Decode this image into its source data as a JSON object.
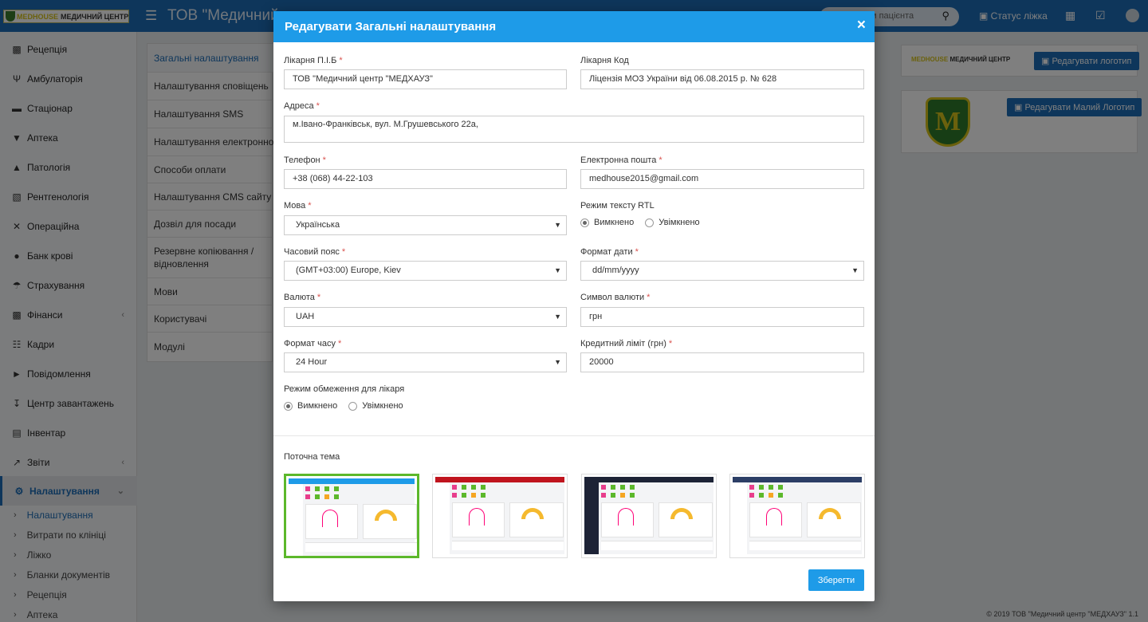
{
  "app": {
    "logo_text_green": "MEDHOUSE",
    "logo_text": "МЕДИЧНИЙ ЦЕНТР",
    "title": "ТОВ \"Медичний",
    "search_placeholder": "ям пацієнта",
    "status_label": "Статус ліжка",
    "footer": "© 2019 ТОВ \"Медичний центр \"МЕДХАУЗ\" 1.1"
  },
  "sidebar": {
    "items": [
      {
        "label": "Рецепція",
        "icon": "reception-icon"
      },
      {
        "label": "Амбулаторія",
        "icon": "stethoscope-icon"
      },
      {
        "label": "Стаціонар",
        "icon": "bed-icon"
      },
      {
        "label": "Аптека",
        "icon": "pharmacy-icon"
      },
      {
        "label": "Патологія",
        "icon": "flask-icon"
      },
      {
        "label": "Рентгенологія",
        "icon": "xray-icon"
      },
      {
        "label": "Операційна",
        "icon": "scissors-icon"
      },
      {
        "label": "Банк крові",
        "icon": "blood-drop-icon"
      },
      {
        "label": "Страхування",
        "icon": "umbrella-icon"
      },
      {
        "label": "Фінанси",
        "icon": "money-icon"
      },
      {
        "label": "Кадри",
        "icon": "staff-icon"
      },
      {
        "label": "Повідомлення",
        "icon": "bullhorn-icon"
      },
      {
        "label": "Центр завантажень",
        "icon": "download-icon"
      },
      {
        "label": "Інвентар",
        "icon": "inventory-icon"
      },
      {
        "label": "Звіти",
        "icon": "chart-icon"
      },
      {
        "label": "Налаштування",
        "icon": "gears-icon"
      }
    ],
    "subitems": [
      "Налаштування",
      "Витрати по клініці",
      "Ліжко",
      "Бланки документів",
      "Рецепція",
      "Аптека"
    ]
  },
  "settings_nav": [
    "Загальні налаштування",
    "Налаштування сповіщень",
    "Налаштування SMS",
    "Налаштування електронної п",
    "Способи оплати",
    "Налаштування CMS сайту",
    "Дозвіл для посади",
    "Резервне копіювання / відновлення",
    "Мови",
    "Користувачі",
    "Модулі"
  ],
  "right_panel": {
    "mini_logo_green": "MEDHOUSE",
    "mini_logo": "МЕДИЧНИЙ ЦЕНТР",
    "edit_logo_btn": "Редагувати логотип",
    "edit_small_logo_btn": "Редагувати Малий Логотип",
    "shield_letter": "M"
  },
  "modal": {
    "title": "Редагувати Загальні налаштування",
    "close_symbol": "×",
    "fields": {
      "hospital_name": {
        "label": "Лікарня П.І.Б",
        "value": "ТОВ \"Медичний центр \"МЕДХАУЗ\""
      },
      "hospital_code": {
        "label": "Лікарня Код",
        "value": "Ліцензія МОЗ України від 06.08.2015 р. № 628"
      },
      "address": {
        "label": "Адреса",
        "value": "м.Івано-Франківськ, вул. М.Грушевського 22а,"
      },
      "phone": {
        "label": "Телефон",
        "value": "+38 (068) 44-22-103"
      },
      "email": {
        "label": "Електронна пошта",
        "value": "medhouse2015@gmail.com"
      },
      "language": {
        "label": "Мова",
        "value": "Українська"
      },
      "rtl": {
        "label": "Режим тексту RTL",
        "off": "Вимкнено",
        "on": "Увімкнено",
        "selected": "off"
      },
      "timezone": {
        "label": "Часовий пояс",
        "value": "(GMT+03:00) Europe, Kiev"
      },
      "date_format": {
        "label": "Формат дати",
        "value": "dd/mm/yyyy"
      },
      "currency": {
        "label": "Валюта",
        "value": "UAH"
      },
      "currency_symbol": {
        "label": "Символ валюти",
        "value": "грн"
      },
      "time_format": {
        "label": "Формат часу",
        "value": "24 Hour"
      },
      "credit_limit": {
        "label": "Кредитний ліміт (грн)",
        "value": "20000"
      },
      "doctor_restriction": {
        "label": "Режим обмеження для лікаря",
        "off": "Вимкнено",
        "on": "Увімкнено",
        "selected": "off"
      }
    },
    "theme_label": "Поточна тема",
    "themes": [
      {
        "name": "blue",
        "bar_color": "#1e9be8",
        "selected": true,
        "dark_side": false
      },
      {
        "name": "red",
        "bar_color": "#c0141e",
        "selected": false,
        "dark_side": false
      },
      {
        "name": "dark",
        "bar_color": "#1d2336",
        "selected": false,
        "dark_side": true
      },
      {
        "name": "navy",
        "bar_color": "#2c3e66",
        "selected": false,
        "dark_side": false
      }
    ],
    "save_label": "Зберегти"
  },
  "colors": {
    "primary": "#1d6db6",
    "modal_header": "#1e9be8",
    "selected_theme": "#5cb82b",
    "required": "#d9534f"
  }
}
